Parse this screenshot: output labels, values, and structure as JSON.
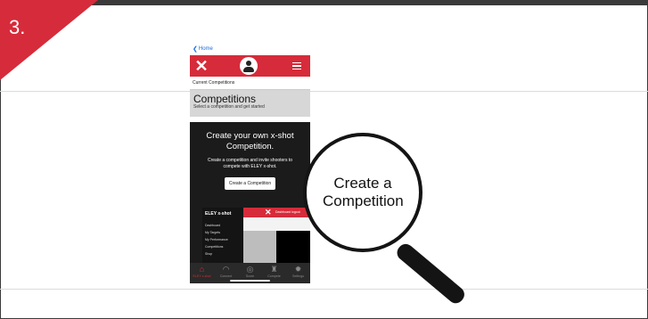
{
  "step": {
    "number": "3."
  },
  "phone": {
    "back_label": "Home",
    "breadcrumb": "Current Competitions",
    "title": "Competitions",
    "subtitle": "Select a competition and get started",
    "panel_heading": "Create your own x-shot Competition.",
    "panel_text": "Create a competition and invite shooters to compete with ELEY x-shot.",
    "create_button": "Create a Competition",
    "mini_site": {
      "brand": "ELEY x-shot",
      "nav": [
        "Dashboard",
        "My Targets",
        "My Performance",
        "Competitions",
        "Shop"
      ],
      "top_links": "Dashboard  logout"
    },
    "tabs": [
      {
        "label": "ELEY x-shot",
        "icon": "home-icon",
        "active": true
      },
      {
        "label": "Connect",
        "icon": "wifi-icon",
        "active": false
      },
      {
        "label": "Score",
        "icon": "target-icon",
        "active": false
      },
      {
        "label": "Compete",
        "icon": "trophy-icon",
        "active": false
      },
      {
        "label": "Settings",
        "icon": "gear-icon",
        "active": false
      }
    ]
  },
  "magnifier": {
    "text": "Create a Competition"
  },
  "colors": {
    "accent": "#d62b3a",
    "dark": "#1b1b1b",
    "frame": "#3a3a3a"
  }
}
